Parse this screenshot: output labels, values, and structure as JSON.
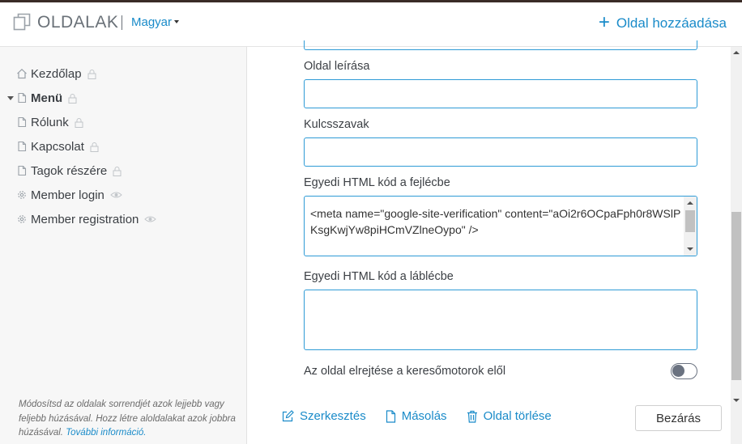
{
  "header": {
    "title": "OLDALAK",
    "language": "Magyar",
    "add_page": "Oldal hozzáadása"
  },
  "sidebar": {
    "items": [
      {
        "label": "Kezdőlap",
        "icon": "home-icon",
        "status": "lock-icon"
      },
      {
        "label": "Menü",
        "icon": "page-icon",
        "status": "lock-icon",
        "bold": true,
        "expanded": true
      },
      {
        "label": "Rólunk",
        "icon": "page-icon",
        "status": "lock-icon"
      },
      {
        "label": "Kapcsolat",
        "icon": "page-icon",
        "status": "lock-icon"
      },
      {
        "label": "Tagok részére",
        "icon": "page-icon",
        "status": "lock-icon"
      },
      {
        "label": "Member login",
        "icon": "gear-icon",
        "status": "eye-icon"
      },
      {
        "label": "Member registration",
        "icon": "gear-icon",
        "status": "eye-icon"
      }
    ],
    "help_text": "Módosítsd az oldalak sorrendjét azok lejjebb vagy feljebb húzásával. Hozz létre aloldalakat azok jobbra húzásával. ",
    "help_link": "További információ."
  },
  "form": {
    "description_label": "Oldal leírása",
    "description_value": "",
    "keywords_label": "Kulcsszavak",
    "keywords_value": "",
    "header_html_label": "Egyedi HTML kód a fejlécbe",
    "header_html_value": "<meta name=\"google-site-verification\" content=\"aOi2r6OCpaFph0r8WSlPKsgKwjYw8piHCmVZlneOypo\" />",
    "footer_html_label": "Egyedi HTML kód a láblécbe",
    "footer_html_value": "",
    "hide_label": "Az oldal elrejtése a keresőmotorok elől",
    "hide_value": false
  },
  "actions": {
    "edit": "Szerkesztés",
    "copy": "Másolás",
    "delete": "Oldal törlése",
    "close": "Bezárás"
  },
  "colors": {
    "accent": "#1a8bc9",
    "input_border": "#2e9bd6",
    "toggle_off": "#6a7280"
  }
}
